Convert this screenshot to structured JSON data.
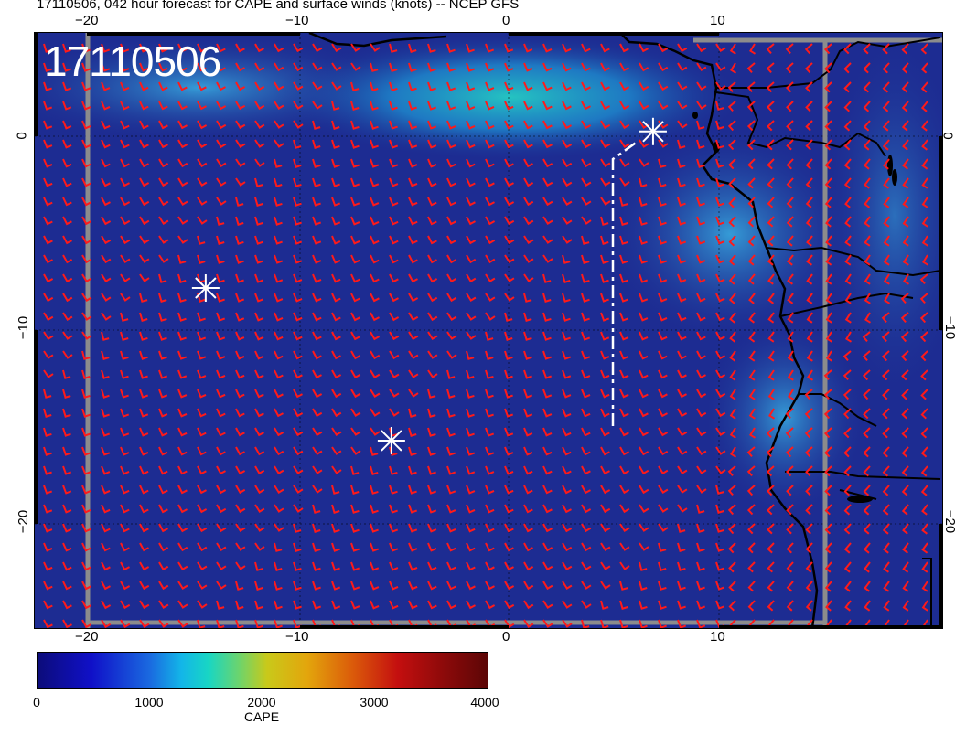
{
  "title": "17110506, 042 hour forecast for CAPE and surface winds (knots) -- NCEP GFS",
  "stamp": "17110506",
  "map": {
    "lon_range": [
      -22.5,
      20.5
    ],
    "lat_range": [
      -25.5,
      5.3
    ],
    "x_ticks": [
      "−20",
      "−10",
      "0",
      "10"
    ],
    "y_ticks": [
      "0",
      "−10",
      "−20"
    ],
    "overlay_color": "#ff1a1a",
    "background_color": "#1d2c92",
    "markers": [
      {
        "name": "star-marker-1",
        "lon": 6.8,
        "lat": 0.2
      },
      {
        "name": "star-marker-2",
        "lon": -14.4,
        "lat": -7.9
      },
      {
        "name": "star-marker-3",
        "lon": -5.6,
        "lat": -15.8
      }
    ]
  },
  "colorbar": {
    "title": "CAPE",
    "ticks": [
      "0",
      "1000",
      "2000",
      "3000",
      "4000"
    ],
    "range": [
      0,
      4000
    ]
  }
}
